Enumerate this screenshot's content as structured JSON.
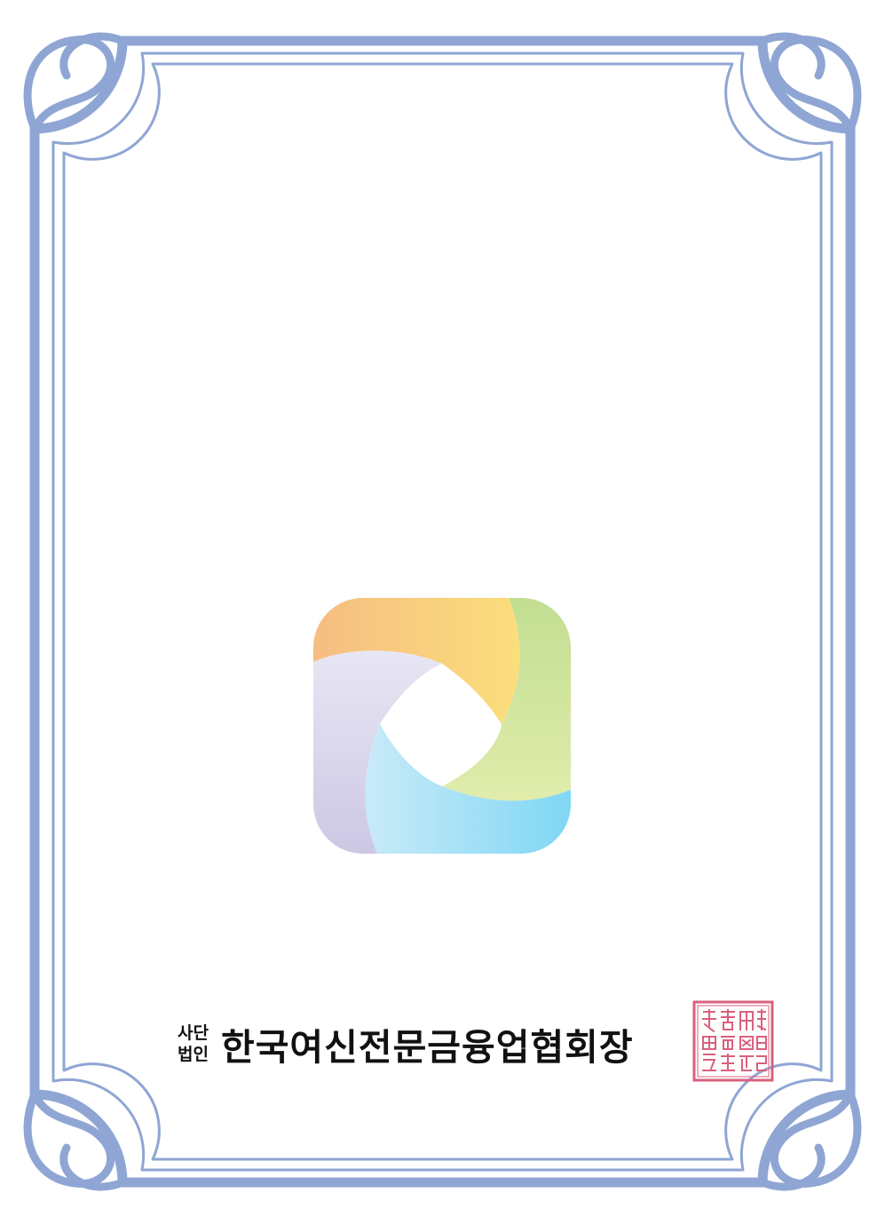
{
  "certificate": {
    "issuer_prefix_line1": "사단",
    "issuer_prefix_line2": "법인",
    "issuer_name": "한국여신전문금융업협회장"
  },
  "seal": {
    "icon": "official-seal-icon",
    "color": "#d9607e"
  },
  "emblem": {
    "icon": "pinwheel-logo-icon",
    "colors": [
      "#f6bd82",
      "#fbde7c",
      "#c2de92",
      "#e0ecab",
      "#7fd7f4",
      "#c9eaf8",
      "#e8e6f4",
      "#cdc7e4"
    ]
  },
  "border": {
    "color": "#8fa6d4"
  }
}
